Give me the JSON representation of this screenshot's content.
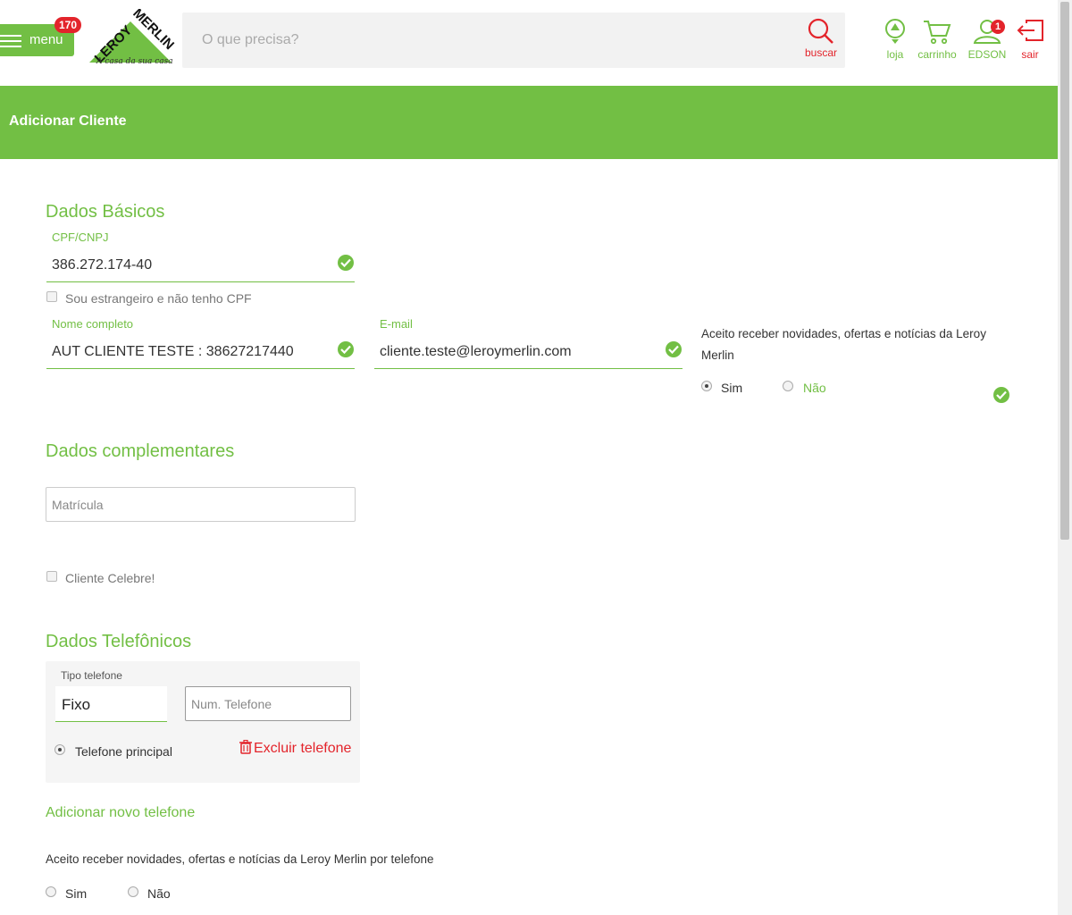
{
  "header": {
    "menu_label": "menu",
    "menu_badge": "170",
    "logo_text": "LEROY MERLIN",
    "logo_tagline": "A casa da sua casa",
    "search_placeholder": "O que precisa?",
    "search_button": "buscar",
    "icons": {
      "loja": "loja",
      "carrinho": "carrinho",
      "user": "EDSON",
      "user_badge": "1",
      "sair": "sair"
    }
  },
  "banner": {
    "title": "Adicionar Cliente"
  },
  "basic": {
    "title": "Dados Básicos",
    "cpf_label": "CPF/CNPJ",
    "cpf_value": "386.272.174-40",
    "foreigner_label": "Sou estrangeiro e não tenho CPF",
    "name_label": "Nome completo",
    "name_value": "AUT CLIENTE TESTE : 38627217440",
    "email_label": "E-mail",
    "email_value": "cliente.teste@leroymerlin.com",
    "newsletter_text": "Aceito receber novidades, ofertas e notícias da Leroy Merlin",
    "newsletter_yes": "Sim",
    "newsletter_no": "Não"
  },
  "complementary": {
    "title": "Dados complementares",
    "matricula_placeholder": "Matrícula",
    "celebrity_label": "Cliente Celebre!"
  },
  "phones": {
    "title": "Dados Telefônicos",
    "tipo_label": "Tipo telefone",
    "tipo_value": "Fixo",
    "number_placeholder": "Num. Telefone",
    "principal_label": "Telefone principal",
    "delete_label": "Excluir telefone",
    "add_label": "Adicionar novo telefone",
    "phone_news_text": "Aceito receber novidades, ofertas e notícias da Leroy Merlin por telefone",
    "phone_news_yes": "Sim",
    "phone_news_no": "Não"
  },
  "colors": {
    "brand_green": "#72bf44",
    "alert_red": "#e3242b"
  }
}
